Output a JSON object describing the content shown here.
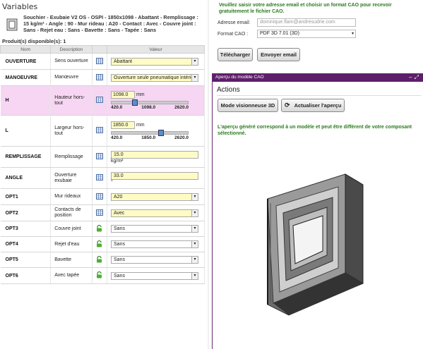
{
  "left": {
    "title": "Variables",
    "product_desc": "Souchier - Exubaie V2 OS - OSPI - 1850x1098 - Abattant - Remplissage : 15 kg/m² - Angle : 90 - Mur rideau : A20 - Contact : Avec - Couvre joint : Sans - Rejet eau : Sans - Bavette : Sans - Tapée : Sans",
    "product_count": "Produit(s) disponible(s): 1",
    "columns": {
      "name": "Nom",
      "desc": "Description",
      "value": "Valeur"
    },
    "rows": {
      "ouverture": {
        "name": "OUVERTURE",
        "desc": "Sens ouverture",
        "value": "Abattant"
      },
      "manoeuvre": {
        "name": "MANOEUVRE",
        "desc": "Manœuvre",
        "value": "Ouverture seule pneumatique intérie"
      },
      "h": {
        "name": "H",
        "desc": "Hauteur hors-tout",
        "value": "1098.0",
        "unit": "mm",
        "min": "420.0",
        "cur": "1098.0",
        "max": "2620.0",
        "level": 0.308
      },
      "l": {
        "name": "L",
        "desc": "Largeur hors-tout",
        "value": "1850.0",
        "unit": "mm",
        "min": "420.0",
        "cur": "1850.0",
        "max": "2620.0",
        "level": 0.65
      },
      "remplissage": {
        "name": "REMPLISSAGE",
        "desc": "Remplissage",
        "value": "15.0",
        "unit": "kg/m²"
      },
      "angle": {
        "name": "ANGLE",
        "desc": "Ouverture exubaie",
        "value": "33.0",
        "unit": "°"
      },
      "opt1": {
        "name": "OPT1",
        "desc": "Mur rideaux",
        "value": "A20"
      },
      "opt2": {
        "name": "OPT2",
        "desc": "Contacts de position",
        "value": "Avec"
      },
      "opt3": {
        "name": "OPT3",
        "desc": "Couvre joint",
        "value": "Sans"
      },
      "opt4": {
        "name": "OPT4",
        "desc": "Rejet d'eau",
        "value": "Sans"
      },
      "opt5": {
        "name": "OPT5",
        "desc": "Bavette",
        "value": "Sans"
      },
      "opt6": {
        "name": "OPT6",
        "desc": "Avec tapée",
        "value": "Sans"
      }
    }
  },
  "form": {
    "message": "Veuillez saisir votre adresse email et choisir un format CAO pour recevoir gratuitement le fichier CAO.",
    "email_label": "Adresse email:",
    "email_placeholder": "dominique.flam@andresudrie.com",
    "format_label": "Format CAO :",
    "format_value": "PDF 3D 7.01 (3D)",
    "download_label": "Télécharger",
    "send_label": "Envoyer email"
  },
  "apercu": {
    "header": "Aperçu du modèle CAO",
    "actions_title": "Actions",
    "viewer_btn": "Mode visionneuse 3D",
    "refresh_btn": "Actualiser l'aperçu",
    "message": "L'aperçu généré correspond à un modèle et peut être différent de votre composant sélectionné."
  },
  "colors": {
    "purple": "#5e1f6a",
    "green": "#2b7a1f",
    "pink_row": "#f6d6f3",
    "field_yellow": "#fefcc4"
  }
}
